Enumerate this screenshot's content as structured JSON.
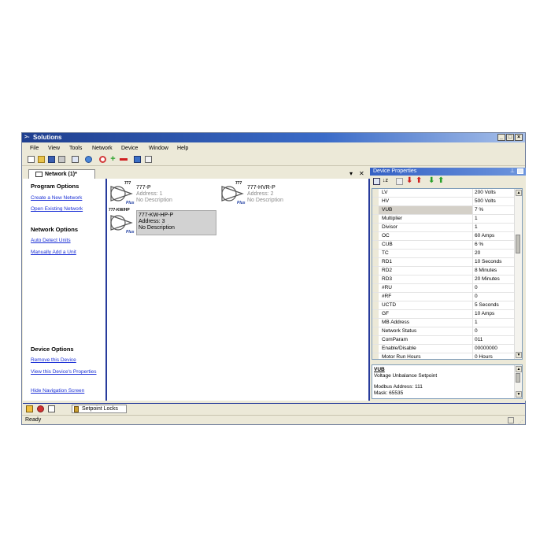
{
  "window": {
    "title": "Solutions"
  },
  "menu": [
    "File",
    "View",
    "Tools",
    "Network",
    "Device",
    "Window",
    "Help"
  ],
  "tab": {
    "label": "Network (1)*"
  },
  "nav": {
    "program_options": "Program Options",
    "create_network": "Create a New Network",
    "open_network": "Open Existing Network",
    "network_options": "Network Options",
    "auto_detect": "Auto Detect Units",
    "manual_add": "Manually Add a Unit",
    "device_options": "Device Options",
    "remove_device": "Remove this Device",
    "view_properties": "View this Device's Properties",
    "hide_nav": "Hide Navigation Screen"
  },
  "devices": [
    {
      "badge": "777",
      "name": "777-P",
      "address": "Address: 1",
      "desc": "No Description",
      "plus": "Plus"
    },
    {
      "badge": "777",
      "name": "777-HVR-P",
      "address": "Address: 2",
      "desc": "No Description",
      "plus": "Plus"
    },
    {
      "badge": "777-KW/HP",
      "name": "777-KW-HP-P",
      "address": "Address: 3",
      "desc": "No Description",
      "plus": "Plus"
    }
  ],
  "props": {
    "title": "Device Properties",
    "rows": [
      {
        "k": "LV",
        "v": "200 Volts"
      },
      {
        "k": "HV",
        "v": "500 Volts"
      },
      {
        "k": "VUB",
        "v": "7 %"
      },
      {
        "k": "Multiplier",
        "v": "1"
      },
      {
        "k": "Divisor",
        "v": "1"
      },
      {
        "k": "OC",
        "v": "60 Amps"
      },
      {
        "k": "CUB",
        "v": "6 %"
      },
      {
        "k": "TC",
        "v": "20"
      },
      {
        "k": "RD1",
        "v": "10 Seconds"
      },
      {
        "k": "RD2",
        "v": "8 Minutes"
      },
      {
        "k": "RD3",
        "v": "20 Minutes"
      },
      {
        "k": "#RU",
        "v": "0"
      },
      {
        "k": "#RF",
        "v": "0"
      },
      {
        "k": "UCTD",
        "v": "5 Seconds"
      },
      {
        "k": "GF",
        "v": "10 Amps"
      },
      {
        "k": "MB Address",
        "v": "1"
      },
      {
        "k": "Network Status",
        "v": "0"
      },
      {
        "k": "ComParam",
        "v": "011"
      },
      {
        "k": "Enable/Disable",
        "v": "00000000"
      },
      {
        "k": "Motor Run Hours",
        "v": "0 Hours"
      }
    ],
    "desc_title": "VUB",
    "desc_text": "Voltage Unbalance Setpoint",
    "desc_modbus": "Modbus Address: 111",
    "desc_mask": "Mask: 65535"
  },
  "bottom_tab": "Setpoint Locks",
  "status": "Ready"
}
